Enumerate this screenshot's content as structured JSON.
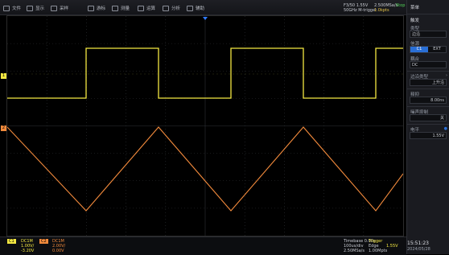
{
  "menu": [
    {
      "icon": "file-icon",
      "label": "文件"
    },
    {
      "icon": "display-icon",
      "label": "显示"
    },
    {
      "icon": "acquire-icon",
      "label": "采样"
    },
    {
      "icon": "cursor-icon",
      "label": "游标"
    },
    {
      "icon": "measure-icon",
      "label": "测量"
    },
    {
      "icon": "math-icon",
      "label": "运算"
    },
    {
      "icon": "analysis-icon",
      "label": "分析"
    },
    {
      "icon": "utility-icon",
      "label": "辅助"
    }
  ],
  "header_right": {
    "line1": "F3/50 1.55V",
    "line2": "50GHz M-trigger",
    "stat1": "2.500MSa/s",
    "stat2": "Stop",
    "stat3": "1.0kpts"
  },
  "sidebar": {
    "title": "触发",
    "menu_label": "菜单",
    "type_label": "类型",
    "type_value": "边沿",
    "source_label": "信源",
    "source_opts": [
      "C1",
      "EXT"
    ],
    "coupling_label": "耦合",
    "coupling_value": "DC",
    "slope_label": "边沿类型",
    "slope_value": "上升沿",
    "holdoff_label": "释抑",
    "holdoff_value": "8.00ns",
    "noise_label": "噪声抑制",
    "noise_value": "关",
    "level_label": "电平",
    "level_value": "1.55V"
  },
  "bottom": {
    "ch1_label": "C1",
    "ch1_coupling": "DC1M",
    "ch1_scale": "1.00V/",
    "ch1_offset": "-3.20V",
    "ch2_label": "C2",
    "ch2_coupling": "DC1M",
    "ch2_scale": "2.00V/",
    "ch2_offset": "0.00V",
    "timebase": "Timebase 0.00s",
    "time_scale": "100us/div",
    "sample_rate": "2.50MSa/s",
    "memory": "1.00Mpts",
    "trigger_label": "Trigger",
    "trigger_mode": "Edge",
    "trigger_level": "1.55V",
    "clock": "15:51:23",
    "date": "2024/05/28"
  },
  "colors": {
    "ch1": "#f4e842",
    "ch2": "#f28a3c",
    "grid": "#2f3236",
    "accent": "#2a6fd6",
    "trigger_marker": "#2f7bff"
  }
}
